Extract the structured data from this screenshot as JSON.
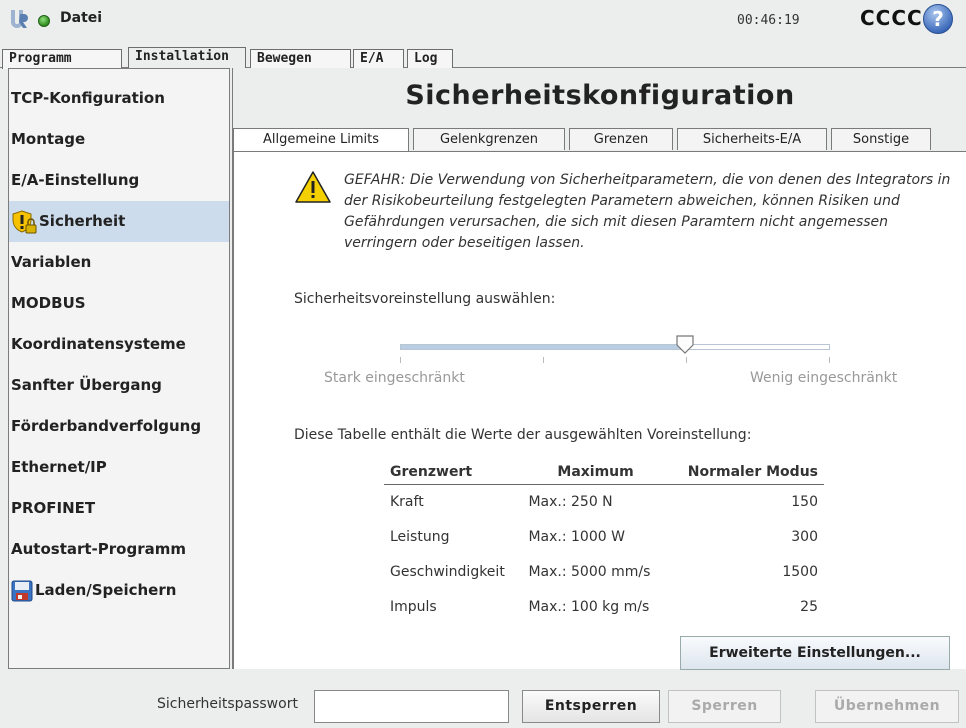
{
  "header": {
    "menu_title": "Datei",
    "clock": "00:46:19",
    "robot_name": "CCCC",
    "help_label": "?"
  },
  "main_tabs": [
    {
      "label": "Programm"
    },
    {
      "label": "Installation"
    },
    {
      "label": "Bewegen"
    },
    {
      "label": "E/A"
    },
    {
      "label": "Log"
    }
  ],
  "sidebar": {
    "items": [
      {
        "label": "TCP-Konfiguration"
      },
      {
        "label": "Montage"
      },
      {
        "label": "E/A-Einstellung"
      },
      {
        "label": "Sicherheit",
        "icon": "shield-lock-icon",
        "active": true
      },
      {
        "label": "Variablen"
      },
      {
        "label": "MODBUS"
      },
      {
        "label": "Koordinatensysteme"
      },
      {
        "label": "Sanfter Übergang"
      },
      {
        "label": "Förderbandverfolgung"
      },
      {
        "label": "Ethernet/IP"
      },
      {
        "label": "PROFINET"
      },
      {
        "label": "Autostart-Programm"
      },
      {
        "label": "Laden/Speichern",
        "icon": "floppy-disk-icon"
      }
    ]
  },
  "content": {
    "title": "Sicherheitskonfiguration",
    "sub_tabs": [
      {
        "label": "Allgemeine Limits",
        "active": true
      },
      {
        "label": "Gelenkgrenzen"
      },
      {
        "label": "Grenzen"
      },
      {
        "label": "Sicherheits-E/A"
      },
      {
        "label": "Sonstige"
      }
    ],
    "warning": "GEFAHR: Die Verwendung von Sicherheitparametern, die von denen des Integrators in der Risikobeurteilung festgelegten Parametern abweichen, können Risiken und Gefährdungen verursachen, die sich mit diesen Paramtern nicht angemessen verringern oder beseitigen lassen.",
    "preset_label": "Sicherheitsvoreinstellung auswählen:",
    "slider": {
      "min_label": "Stark eingeschränkt",
      "max_label": "Wenig eingeschränkt",
      "value_fraction": 0.667,
      "steps": 4
    },
    "table_label": "Diese Tabelle enthält die Werte der ausgewählten Voreinstellung:",
    "table": {
      "headers": [
        "Grenzwert",
        "Maximum",
        "Normaler Modus"
      ],
      "rows": [
        {
          "limit": "Kraft",
          "max": "Max.: 250 N",
          "normal": "150"
        },
        {
          "limit": "Leistung",
          "max": "Max.: 1000 W",
          "normal": "300"
        },
        {
          "limit": "Geschwindigkeit",
          "max": "Max.: 5000 mm/s",
          "normal": "1500"
        },
        {
          "limit": "Impuls",
          "max": "Max.: 100 kg m/s",
          "normal": "25"
        }
      ]
    },
    "advanced_button": "Erweiterte Einstellungen..."
  },
  "footer": {
    "password_label": "Sicherheitspasswort",
    "password_value": "",
    "unlock_button": "Entsperren",
    "lock_button": "Sperren",
    "apply_button": "Übernehmen"
  },
  "colors": {
    "active_sidebar": "#cddcec",
    "status_green": "#2e8b1e",
    "help_blue": "#3866b8",
    "warning_yellow": "#f5d000"
  }
}
